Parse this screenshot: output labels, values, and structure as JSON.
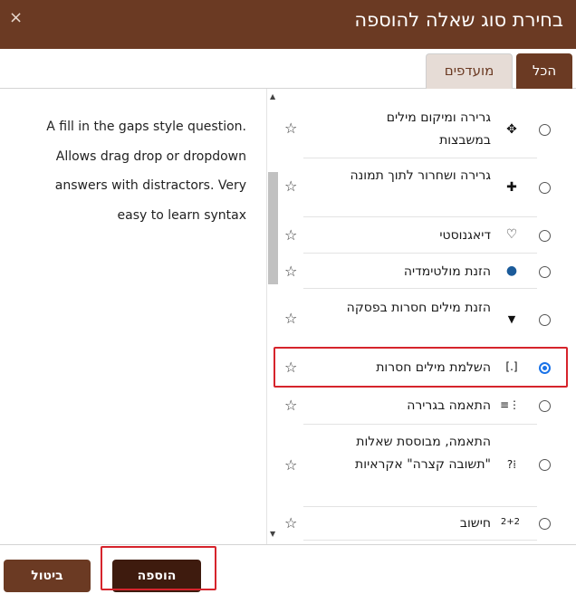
{
  "dialog": {
    "title": "בחירת סוג שאלה להוספה",
    "close_icon": "×"
  },
  "tabs": [
    {
      "label": "הכל",
      "active": true
    },
    {
      "label": "מועדפים",
      "active": false
    }
  ],
  "question_types": [
    {
      "label": "גרירה ומיקום מילים במשבצות",
      "icon": "move-arrows-icon",
      "selected": false
    },
    {
      "label": "גרירה ושחרור לתוך תמונה",
      "icon": "crosshair-icon",
      "selected": false
    },
    {
      "label": "דיאגנוסטי",
      "icon": "stethoscope-icon",
      "selected": false
    },
    {
      "label": "הזנת מולטימדיה",
      "icon": "multimedia-icon",
      "selected": false
    },
    {
      "label": "הזנת מילים חסרות בפסקה",
      "icon": "dropdown-caret-icon",
      "selected": false
    },
    {
      "label": "השלמת מילים חסרות",
      "icon": "gapfill-icon",
      "selected": true
    },
    {
      "label": "התאמה בגרירה",
      "icon": "drag-match-icon",
      "selected": false
    },
    {
      "label": "התאמה, מבוססת שאלות \"תשובה קצרה\" אקראיות",
      "icon": "random-match-icon",
      "selected": false
    },
    {
      "label": "חישוב",
      "icon": "calculated-icon",
      "selected": false
    }
  ],
  "description": "A fill in the gaps style question. Allows drag drop or dropdown answers with distractors. Very easy to learn syntax",
  "footer": {
    "add_label": "הוספה",
    "cancel_label": "ביטול"
  },
  "colors": {
    "brand": "#6b3a23",
    "brand_dark": "#3e1b0e",
    "highlight": "#d6242c",
    "radio_selected": "#1a73e8"
  }
}
